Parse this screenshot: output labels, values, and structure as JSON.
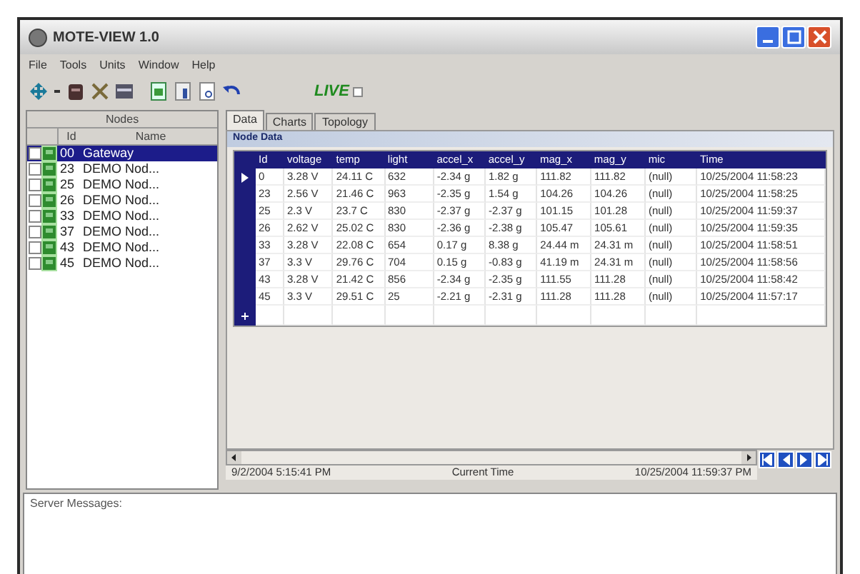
{
  "window": {
    "title": "MOTE-VIEW 1.0"
  },
  "menu": [
    "File",
    "Tools",
    "Units",
    "Window",
    "Help"
  ],
  "toolbar": {
    "live_label": "LIVE",
    "live_checked": false
  },
  "nodes": {
    "title": "Nodes",
    "columns": [
      "Id",
      "Name"
    ],
    "rows": [
      {
        "id": "00",
        "name": "Gateway",
        "checked": false,
        "selected": true
      },
      {
        "id": "23",
        "name": "DEMO Nod...",
        "checked": false,
        "selected": false
      },
      {
        "id": "25",
        "name": "DEMO Nod...",
        "checked": false,
        "selected": false
      },
      {
        "id": "26",
        "name": "DEMO Nod...",
        "checked": false,
        "selected": false
      },
      {
        "id": "33",
        "name": "DEMO Nod...",
        "checked": false,
        "selected": false
      },
      {
        "id": "37",
        "name": "DEMO Nod...",
        "checked": false,
        "selected": false
      },
      {
        "id": "43",
        "name": "DEMO Nod...",
        "checked": false,
        "selected": false
      },
      {
        "id": "45",
        "name": "DEMO Nod...",
        "checked": false,
        "selected": false
      }
    ]
  },
  "tabs": [
    {
      "label": "Data",
      "selected": true
    },
    {
      "label": "Charts",
      "selected": false
    },
    {
      "label": "Topology",
      "selected": false
    }
  ],
  "table": {
    "title": "Node Data",
    "columns": [
      "Id",
      "voltage",
      "temp",
      "light",
      "accel_x",
      "accel_y",
      "mag_x",
      "mag_y",
      "mic",
      "Time"
    ],
    "rows": [
      [
        "0",
        "3.28 V",
        "24.11 C",
        "632",
        "-2.34 g",
        "1.82 g",
        "111.82",
        "111.82",
        "(null)",
        "10/25/2004 11:58:23"
      ],
      [
        "23",
        "2.56 V",
        "21.46 C",
        "963",
        "-2.35 g",
        "1.54 g",
        "104.26",
        "104.26",
        "(null)",
        "10/25/2004 11:58:25"
      ],
      [
        "25",
        "2.3 V",
        "23.7 C",
        "830",
        "-2.37 g",
        "-2.37 g",
        "101.15",
        "101.28",
        "(null)",
        "10/25/2004 11:59:37"
      ],
      [
        "26",
        "2.62 V",
        "25.02 C",
        "830",
        "-2.36 g",
        "-2.38 g",
        "105.47",
        "105.61",
        "(null)",
        "10/25/2004 11:59:35"
      ],
      [
        "33",
        "3.28 V",
        "22.08 C",
        "654",
        "0.17 g",
        "8.38 g",
        "24.44 m",
        "24.31 m",
        "(null)",
        "10/25/2004 11:58:51"
      ],
      [
        "37",
        "3.3 V",
        "29.76 C",
        "704",
        "0.15 g",
        "-0.83 g",
        "41.19 m",
        "24.31 m",
        "(null)",
        "10/25/2004 11:58:56"
      ],
      [
        "43",
        "3.28 V",
        "21.42 C",
        "856",
        "-2.34 g",
        "-2.35 g",
        "111.55",
        "111.28",
        "(null)",
        "10/25/2004 11:58:42"
      ],
      [
        "45",
        "3.3 V",
        "29.51 C",
        "25",
        "-2.21 g",
        "-2.31 g",
        "111.28",
        "111.28",
        "(null)",
        "10/25/2004 11:57:17"
      ]
    ]
  },
  "time_bar": {
    "start": "9/2/2004 5:15:41 PM",
    "label": "Current Time",
    "end": "10/25/2004 11:59:37 PM"
  },
  "messages": {
    "label": "Server Messages:"
  }
}
